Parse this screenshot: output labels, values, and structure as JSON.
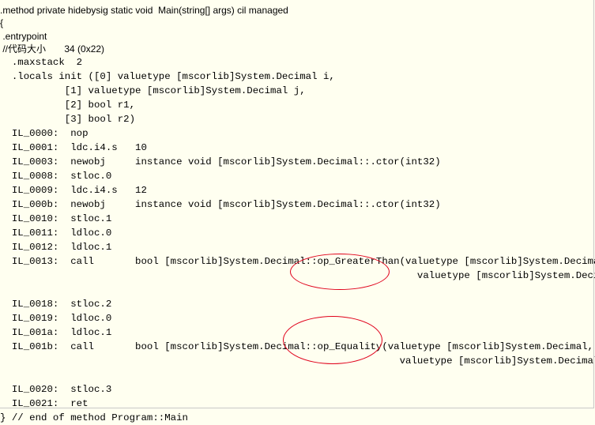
{
  "il": {
    "header": ".method private hidebysig static void  Main(string[] args) cil managed",
    "open_brace": "{",
    "entrypoint": " .entrypoint",
    "code_size": " //代码大小       34 (0x22)",
    "lines": [
      "  .maxstack  2",
      "  .locals init ([0] valuetype [mscorlib]System.Decimal i,",
      "           [1] valuetype [mscorlib]System.Decimal j,",
      "           [2] bool r1,",
      "           [3] bool r2)",
      "  IL_0000:  nop",
      "  IL_0001:  ldc.i4.s   10",
      "  IL_0003:  newobj     instance void [mscorlib]System.Decimal::.ctor(int32)",
      "  IL_0008:  stloc.0",
      "  IL_0009:  ldc.i4.s   12",
      "  IL_000b:  newobj     instance void [mscorlib]System.Decimal::.ctor(int32)",
      "  IL_0010:  stloc.1",
      "  IL_0011:  ldloc.0",
      "  IL_0012:  ldloc.1",
      "  IL_0013:  call       bool [mscorlib]System.Decimal::op_GreaterThan(valuetype [mscorlib]System.Decimal,",
      "                                                                       valuetype [mscorlib]System.Decimal)",
      "",
      "  IL_0018:  stloc.2",
      "  IL_0019:  ldloc.0",
      "  IL_001a:  ldloc.1",
      "  IL_001b:  call       bool [mscorlib]System.Decimal::op_Equality(valuetype [mscorlib]System.Decimal,",
      "                                                                    valuetype [mscorlib]System.Decimal)",
      "",
      "  IL_0020:  stloc.3",
      "  IL_0021:  ret",
      "} // end of method Program::Main"
    ]
  },
  "annotations": {
    "color": "#e0001a",
    "highlighted": [
      "op_GreaterThan",
      "op_Equality"
    ]
  }
}
